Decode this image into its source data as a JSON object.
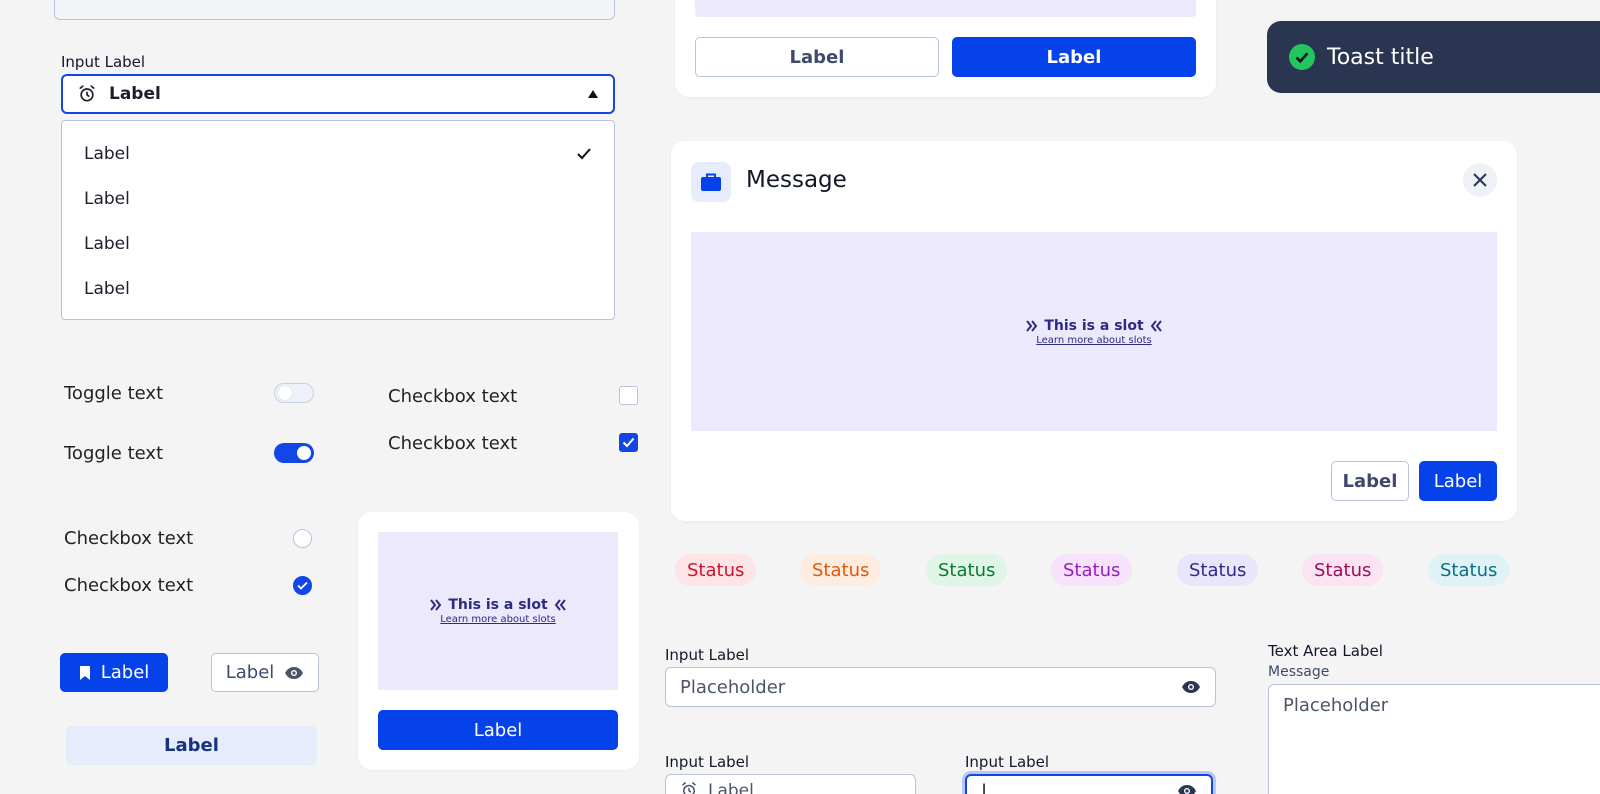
{
  "select": {
    "label": "Input Label",
    "value": "Label",
    "options": [
      "Label",
      "Label",
      "Label",
      "Label"
    ]
  },
  "toggles": [
    {
      "text": "Toggle text",
      "on": false
    },
    {
      "text": "Toggle text",
      "on": true
    }
  ],
  "checkboxes": [
    {
      "text": "Checkbox text",
      "checked": false
    },
    {
      "text": "Checkbox text",
      "checked": true
    }
  ],
  "radios": [
    {
      "text": "Checkbox text",
      "checked": false
    },
    {
      "text": "Checkbox text",
      "checked": true
    }
  ],
  "buttons": {
    "bookmark": "Label",
    "eye": "Label",
    "ghost": "Label"
  },
  "slot_card": {
    "slot_title": "This is a slot",
    "slot_link": "Learn more about slots",
    "button": "Label"
  },
  "top_card": {
    "secondary": "Label",
    "primary": "Label"
  },
  "toast": {
    "title": "Toast title"
  },
  "modal": {
    "title": "Message",
    "slot_title": "This is a slot",
    "slot_link": "Learn more about slots",
    "secondary": "Label",
    "primary": "Label"
  },
  "badges": [
    {
      "text": "Status",
      "bg": "#fde4e7",
      "fg": "#d0122f"
    },
    {
      "text": "Status",
      "bg": "#fdecdf",
      "fg": "#e2580a"
    },
    {
      "text": "Status",
      "bg": "#dff5e6",
      "fg": "#0b7a35"
    },
    {
      "text": "Status",
      "bg": "#f6e2fb",
      "fg": "#9a1bc4"
    },
    {
      "text": "Status",
      "bg": "#e8e6fb",
      "fg": "#2e2a8c"
    },
    {
      "text": "Status",
      "bg": "#fce3f1",
      "fg": "#9d0c5e"
    },
    {
      "text": "Status",
      "bg": "#dff3f7",
      "fg": "#0a6f85"
    }
  ],
  "inputs": {
    "password": {
      "label": "Input Label",
      "placeholder": "Placeholder"
    },
    "icon_field": {
      "label": "Input Label",
      "value": "Label"
    },
    "focus_field": {
      "label": "Input Label",
      "value": "|"
    },
    "textarea": {
      "label": "Text Area Label",
      "sublabel": "Message",
      "placeholder": "Placeholder"
    }
  },
  "colors": {
    "primary": "#0542e9",
    "toast_bg": "#2a3552",
    "success": "#22c55e",
    "slot_bg": "#ebe9fb"
  }
}
